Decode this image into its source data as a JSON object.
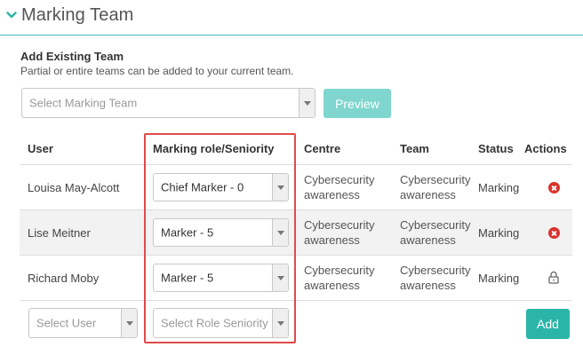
{
  "header": {
    "title": "Marking Team"
  },
  "add_existing": {
    "title": "Add Existing Team",
    "subtitle": "Partial or entire teams can be added to your current team.",
    "select_placeholder": "Select Marking Team",
    "preview_label": "Preview"
  },
  "table": {
    "columns": {
      "user": "User",
      "role": "Marking role/Seniority",
      "centre": "Centre",
      "team": "Team",
      "status": "Status",
      "actions": "Actions"
    },
    "rows": [
      {
        "user": "Louisa May-Alcott",
        "role": "Chief Marker - 0",
        "centre_1": "Cybersecurity",
        "centre_2": "awareness",
        "team_1": "Cybersecurity",
        "team_2": "awareness",
        "status": "Marking",
        "action_icon": "remove-icon"
      },
      {
        "user": "Lise Meitner",
        "role": "Marker - 5",
        "centre_1": "Cybersecurity",
        "centre_2": "awareness",
        "team_1": "Cybersecurity",
        "team_2": "awareness",
        "status": "Marking",
        "action_icon": "remove-icon"
      },
      {
        "user": "Richard Moby",
        "role": "Marker - 5",
        "centre_1": "Cybersecurity",
        "centre_2": "awareness",
        "team_1": "Cybersecurity",
        "team_2": "awareness",
        "status": "Marking",
        "action_icon": "lock-icon"
      }
    ],
    "new_row": {
      "user_placeholder": "Select User",
      "role_placeholder": "Select Role Seniority",
      "add_label": "Add"
    }
  },
  "colors": {
    "accent": "#4bbcc4",
    "preview_button": "#7fd6cf",
    "add_button": "#2bb5a8",
    "highlight": "#e04b4b",
    "remove_icon": "#d9332b"
  }
}
